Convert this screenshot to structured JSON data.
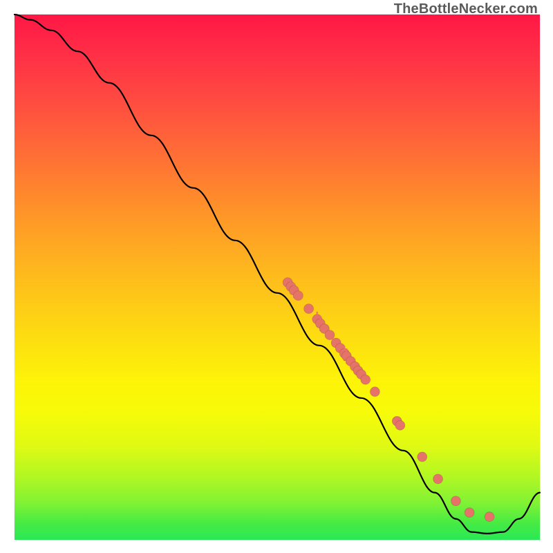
{
  "watermark": "TheBottleNecker.com",
  "chart_data": {
    "type": "line",
    "title": "",
    "xlabel": "",
    "ylabel": "",
    "xlim": [
      0,
      100
    ],
    "ylim": [
      0,
      100
    ],
    "grid": false,
    "curve": [
      {
        "x": 0,
        "y": 100
      },
      {
        "x": 3,
        "y": 99
      },
      {
        "x": 7,
        "y": 97
      },
      {
        "x": 12,
        "y": 93
      },
      {
        "x": 18,
        "y": 87
      },
      {
        "x": 26,
        "y": 77
      },
      {
        "x": 34,
        "y": 67
      },
      {
        "x": 42,
        "y": 57
      },
      {
        "x": 50,
        "y": 47
      },
      {
        "x": 58,
        "y": 37
      },
      {
        "x": 66,
        "y": 27
      },
      {
        "x": 74,
        "y": 17
      },
      {
        "x": 80,
        "y": 9
      },
      {
        "x": 84,
        "y": 4
      },
      {
        "x": 87,
        "y": 1.5
      },
      {
        "x": 90,
        "y": 1.2
      },
      {
        "x": 93,
        "y": 1.5
      },
      {
        "x": 96,
        "y": 4
      },
      {
        "x": 100,
        "y": 9
      }
    ],
    "markers": [
      {
        "x": 52.0,
        "y": 49.0
      },
      {
        "x": 52.6,
        "y": 48.2
      },
      {
        "x": 53.2,
        "y": 47.5
      },
      {
        "x": 54.0,
        "y": 46.5
      },
      {
        "x": 56.0,
        "y": 44.0
      },
      {
        "x": 57.6,
        "y": 42.0
      },
      {
        "x": 58.2,
        "y": 41.2
      },
      {
        "x": 59.0,
        "y": 40.2
      },
      {
        "x": 60.0,
        "y": 39.0
      },
      {
        "x": 61.2,
        "y": 37.5
      },
      {
        "x": 62.0,
        "y": 36.5
      },
      {
        "x": 62.8,
        "y": 35.5
      },
      {
        "x": 63.2,
        "y": 35.0
      },
      {
        "x": 64.0,
        "y": 34.0
      },
      {
        "x": 64.8,
        "y": 33.0
      },
      {
        "x": 65.4,
        "y": 32.2
      },
      {
        "x": 66.0,
        "y": 31.5
      },
      {
        "x": 66.8,
        "y": 30.5
      },
      {
        "x": 68.6,
        "y": 28.2
      },
      {
        "x": 72.8,
        "y": 22.6
      },
      {
        "x": 73.4,
        "y": 21.8
      },
      {
        "x": 77.6,
        "y": 15.8
      },
      {
        "x": 80.6,
        "y": 11.6
      },
      {
        "x": 84.0,
        "y": 7.4
      },
      {
        "x": 86.6,
        "y": 5.2
      },
      {
        "x": 90.4,
        "y": 4.4
      }
    ],
    "marker_clusters_with_ticks": [
      52.6,
      53.2,
      57.6,
      58.2,
      62.8,
      63.2
    ]
  }
}
